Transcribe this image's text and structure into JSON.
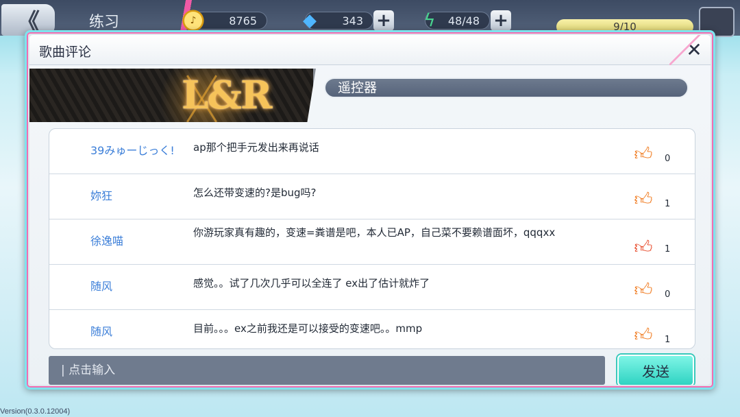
{
  "background": {
    "screen_title": "练习",
    "back_symbol": "《",
    "resources": {
      "coins": "8765",
      "gems": "343",
      "energy": "48/48"
    },
    "progress": "9/10",
    "version": "Version(0.3.0.12004)"
  },
  "dialog": {
    "title": "歌曲评论",
    "close_symbol": "✕",
    "banner_logo": "L&R",
    "song_name": "遥控器",
    "comments": [
      {
        "user": "39みゅーじっく!",
        "text": "ap那个把手元发出来再说话",
        "likes": "0",
        "liked": false
      },
      {
        "user": "妳狂",
        "text": "怎么还带变速的?是bug吗?",
        "likes": "1",
        "liked": false
      },
      {
        "user": "徐逸喵",
        "text": "你游玩家真有趣的，变速=粪谱是吧，本人已AP，自己菜不要赖谱面坏，qqqxx",
        "likes": "1",
        "liked": true
      },
      {
        "user": "随风",
        "text": "感觉。。试了几次几乎可以全连了 ex出了估计就炸了",
        "likes": "0",
        "liked": false
      },
      {
        "user": "随风",
        "text": "目前。。。ex之前我还是可以接受的变速吧。。mmp",
        "likes": "1",
        "liked": false
      }
    ],
    "input_placeholder": "| 点击输入",
    "send_label": "发送"
  },
  "colors": {
    "accent_cyan": "#2fd3c2",
    "accent_pink": "#f26db0",
    "username_blue": "#3b7ed8",
    "like_orange": "#f07a1e"
  },
  "icons": {
    "like": "thumbs-up-icon",
    "close": "close-icon",
    "coin": "coin-icon",
    "gem": "diamond-icon",
    "energy": "lightning-icon"
  }
}
